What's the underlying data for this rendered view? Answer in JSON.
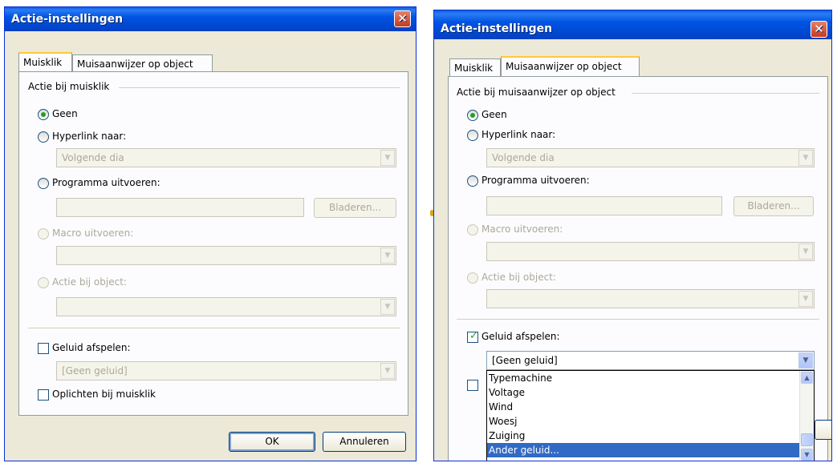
{
  "left": {
    "title": "Actie-instellingen",
    "close": "✕",
    "tabs": [
      "Muisklik",
      "Muisaanwijzer op object"
    ],
    "group_label": "Actie bij muisklik",
    "options": {
      "none": "Geen",
      "hyperlink": "Hyperlink naar:",
      "hyperlink_value": "Volgende dia",
      "program": "Programma uitvoeren:",
      "browse": "Bladeren...",
      "macro": "Macro uitvoeren:",
      "object_action": "Actie bij object:"
    },
    "sound": "Geluid afspelen:",
    "sound_value": "[Geen geluid]",
    "highlight": "Oplichten bij muisklik",
    "ok": "OK",
    "cancel": "Annuleren"
  },
  "right": {
    "title": "Actie-instellingen",
    "close": "✕",
    "tabs": [
      "Muisklik",
      "Muisaanwijzer op object"
    ],
    "group_label": "Actie bij muisaanwijzer op object",
    "options": {
      "none": "Geen",
      "hyperlink": "Hyperlink naar:",
      "hyperlink_value": "Volgende dia",
      "program": "Programma uitvoeren:",
      "browse": "Bladeren...",
      "macro": "Macro uitvoeren:",
      "object_action": "Actie bij object:"
    },
    "sound": "Geluid afspelen:",
    "sound_value": "[Geen geluid]",
    "sound_options": [
      "Typemachine",
      "Voltage",
      "Wind",
      "Woesj",
      "Zuiging",
      "Ander geluid..."
    ]
  }
}
